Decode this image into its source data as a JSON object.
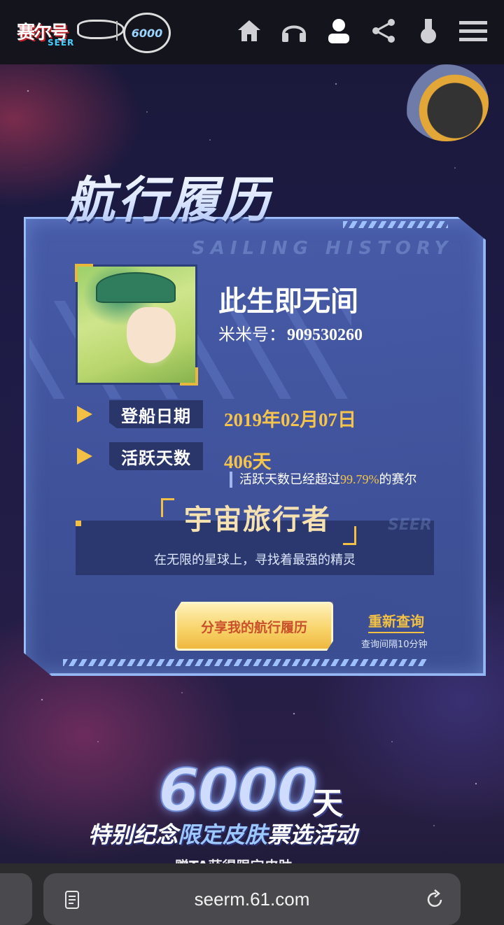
{
  "header": {
    "logo_text": "赛尔号",
    "logo_sub": "SEER",
    "badge_text": "6000",
    "nav": [
      {
        "icon": "home-icon"
      },
      {
        "icon": "headphones-icon"
      },
      {
        "icon": "user-icon"
      },
      {
        "icon": "share-icon"
      },
      {
        "icon": "potion-icon"
      },
      {
        "icon": "menu-icon"
      }
    ]
  },
  "card": {
    "title": "航行履历",
    "subtitle": "SAILING HISTORY",
    "player_name": "此生即无间",
    "player_id_label": "米米号：",
    "player_id": "909530260",
    "boarding_label": "登船日期",
    "boarding_date": "2019年02月07日",
    "active_label": "活跃天数",
    "active_days": "406天",
    "active_note_pre": "活跃天数已经超过",
    "active_percent": "99.79%",
    "active_note_post": "的赛尔",
    "rank_title": "宇宙旅行者",
    "rank_desc": "在无限的星球上，寻找着最强的精灵",
    "rank_watermark": "SEER",
    "share_label": "分享我的航行履历",
    "requery_label": "重新查询",
    "requery_note": "查询间隔10分钟"
  },
  "promo": {
    "big_number": "6000",
    "big_unit": "天",
    "line_pre": "特别纪念",
    "line_highlight": "限定皮肤",
    "line_post": "票选活动",
    "cut_line": "赠TA获得限定皮肤"
  },
  "browser": {
    "url": "seerm.61.com"
  },
  "colors": {
    "accent_gold": "#f4c44d",
    "card_blue": "#4a60b0",
    "header_bg": "#14141c"
  }
}
